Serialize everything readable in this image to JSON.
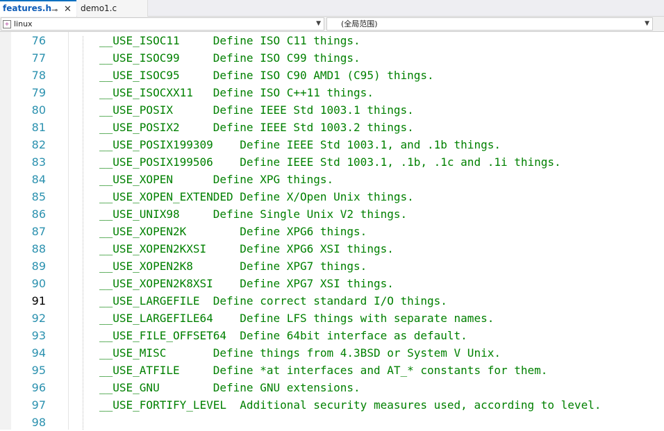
{
  "tabs": {
    "active": {
      "label": "features.h",
      "pin_icon": "pin-icon",
      "close_icon": "close-icon"
    },
    "inactive": {
      "label": "demo1.c"
    }
  },
  "nav": {
    "project": "linux",
    "scope": "(全局范围)"
  },
  "colors": {
    "accent": "#0e70c0",
    "comment": "#008000",
    "line_number": "#2b91af"
  },
  "editor": {
    "current_line": "91",
    "lines": [
      {
        "num": "76",
        "text": "__USE_ISOC11     Define ISO C11 things."
      },
      {
        "num": "77",
        "text": "__USE_ISOC99     Define ISO C99 things."
      },
      {
        "num": "78",
        "text": "__USE_ISOC95     Define ISO C90 AMD1 (C95) things."
      },
      {
        "num": "79",
        "text": "__USE_ISOCXX11   Define ISO C++11 things."
      },
      {
        "num": "80",
        "text": "__USE_POSIX      Define IEEE Std 1003.1 things."
      },
      {
        "num": "81",
        "text": "__USE_POSIX2     Define IEEE Std 1003.2 things."
      },
      {
        "num": "82",
        "text": "__USE_POSIX199309    Define IEEE Std 1003.1, and .1b things."
      },
      {
        "num": "83",
        "text": "__USE_POSIX199506    Define IEEE Std 1003.1, .1b, .1c and .1i things."
      },
      {
        "num": "84",
        "text": "__USE_XOPEN      Define XPG things."
      },
      {
        "num": "85",
        "text": "__USE_XOPEN_EXTENDED Define X/Open Unix things."
      },
      {
        "num": "86",
        "text": "__USE_UNIX98     Define Single Unix V2 things."
      },
      {
        "num": "87",
        "text": "__USE_XOPEN2K        Define XPG6 things."
      },
      {
        "num": "88",
        "text": "__USE_XOPEN2KXSI     Define XPG6 XSI things."
      },
      {
        "num": "89",
        "text": "__USE_XOPEN2K8       Define XPG7 things."
      },
      {
        "num": "90",
        "text": "__USE_XOPEN2K8XSI    Define XPG7 XSI things."
      },
      {
        "num": "91",
        "text": "__USE_LARGEFILE  Define correct standard I/O things."
      },
      {
        "num": "92",
        "text": "__USE_LARGEFILE64    Define LFS things with separate names."
      },
      {
        "num": "93",
        "text": "__USE_FILE_OFFSET64  Define 64bit interface as default."
      },
      {
        "num": "94",
        "text": "__USE_MISC       Define things from 4.3BSD or System V Unix."
      },
      {
        "num": "95",
        "text": "__USE_ATFILE     Define *at interfaces and AT_* constants for them."
      },
      {
        "num": "96",
        "text": "__USE_GNU        Define GNU extensions."
      },
      {
        "num": "97",
        "text": "__USE_FORTIFY_LEVEL  Additional security measures used, according to level."
      },
      {
        "num": "98",
        "text": ""
      }
    ]
  }
}
